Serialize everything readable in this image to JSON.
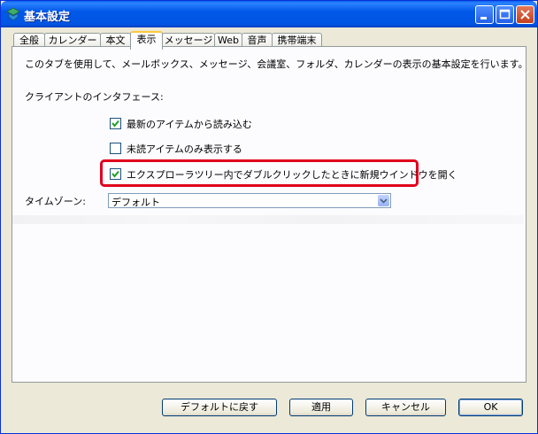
{
  "window": {
    "title": "基本設定"
  },
  "tabs": [
    {
      "label": "全般"
    },
    {
      "label": "カレンダー"
    },
    {
      "label": "本文"
    },
    {
      "label": "表示"
    },
    {
      "label": "メッセージ"
    },
    {
      "label": "Web"
    },
    {
      "label": "音声"
    },
    {
      "label": "携帯端末"
    }
  ],
  "active_tab": "表示",
  "content": {
    "description": "このタブを使用して、メールボックス、メッセージ、会議室、フォルダ、カレンダーの表示の基本設定を行います。",
    "client_interface_label": "クライアントのインタフェース:",
    "options": [
      {
        "label": "最新のアイテムから読み込む",
        "checked": true
      },
      {
        "label": "未読アイテムのみ表示する",
        "checked": false
      },
      {
        "label": "エクスプローラツリー内でダブルクリックしたときに新規ウインドウを開く",
        "checked": true
      }
    ],
    "timezone_label": "タイムゾーン:",
    "timezone_value": "デフォルト"
  },
  "buttons": {
    "reset": "デフォルトに戻す",
    "apply": "適用",
    "cancel": "キャンセル",
    "ok": "OK"
  },
  "colors": {
    "highlight": "#e0001c",
    "title_bar": "#0158e8"
  }
}
